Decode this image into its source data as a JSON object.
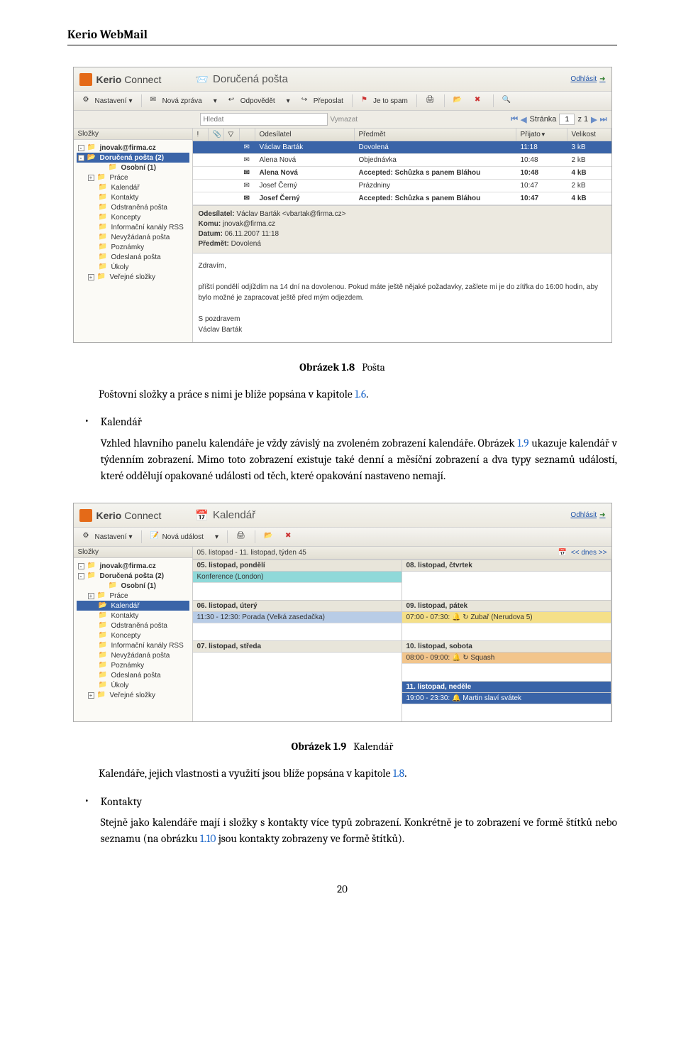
{
  "doc": {
    "header": "Kerio WebMail",
    "caption1_label": "Obrázek 1.8",
    "caption1_text": "Pošta",
    "para1": "Poštovní složky a práce s nimi je blíže popsána v kapitole ",
    "para1_link": "1.6",
    "para1_end": ".",
    "bullet1_title": "Kalendář",
    "bullet1_body_a": "Vzhled hlavního panelu kalendáře je vždy závislý na zvoleném zobrazení kalendáře. Obrázek ",
    "bullet1_link": "1.9",
    "bullet1_body_b": " ukazuje kalendář v týdenním zobrazení. Mimo toto zobrazení existuje také denní a měsíční zobrazení a dva typy seznamů událostí, které oddělují opakované události od těch, které opakování nastaveno nemají.",
    "caption2_label": "Obrázek 1.9",
    "caption2_text": "Kalendář",
    "para2_a": "Kalendáře, jejich vlastnosti a využití jsou blíže popsána v kapitole ",
    "para2_link": "1.8",
    "para2_end": ".",
    "bullet2_title": "Kontakty",
    "bullet2_body_a": "Stejně jako kalendáře mají i složky s kontakty více typů zobrazení. Konkrétně je to zobrazení ve formě štítků nebo seznamu (na obrázku ",
    "bullet2_link": "1.10",
    "bullet2_body_b": " jsou kontakty zobrazeny ve formě štítků).",
    "page_number": "20"
  },
  "app": {
    "brand": "Kerio",
    "product": "Connect",
    "title1": "Doručená pošta",
    "title2": "Kalendář",
    "logout": "Odhlásit"
  },
  "toolbar": {
    "settings": "Nastavení",
    "new_msg": "Nová zpráva",
    "reply": "Odpovědět",
    "forward": "Přeposlat",
    "spam": "Je to spam",
    "new_event": "Nová událost"
  },
  "search": {
    "placeholder": "Hledat",
    "clear": "Vymazat",
    "page_label": "Stránka",
    "page_value": "1",
    "page_total": "z 1"
  },
  "sidebar": {
    "header": "Složky",
    "items": [
      {
        "label": "jnovak@firma.cz",
        "exp": "-",
        "bold": true
      },
      {
        "label": "Doručená pošta (2)",
        "exp": "-",
        "bold": true,
        "sel_mail": true
      },
      {
        "label": "Osobní (1)",
        "bold": true,
        "indent": 2
      },
      {
        "label": "Práce",
        "exp": "+",
        "indent": 1
      },
      {
        "label": "Kalendář",
        "indent": 1,
        "sel_cal": true
      },
      {
        "label": "Kontakty",
        "indent": 1
      },
      {
        "label": "Odstraněná pošta",
        "indent": 1
      },
      {
        "label": "Koncepty",
        "indent": 1
      },
      {
        "label": "Informační kanály RSS",
        "indent": 1
      },
      {
        "label": "Nevyžádaná pošta",
        "indent": 1
      },
      {
        "label": "Poznámky",
        "indent": 1
      },
      {
        "label": "Odeslaná pošta",
        "indent": 1
      },
      {
        "label": "Úkoly",
        "indent": 1
      },
      {
        "label": "Veřejné složky",
        "exp": "+",
        "indent": 1
      }
    ]
  },
  "mail": {
    "cols": {
      "from": "Odesílatel",
      "subject": "Předmět",
      "date": "Přijato",
      "size": "Velikost"
    },
    "rows": [
      {
        "from": "Václav Barták",
        "subj": "Dovolená",
        "date": "11:18",
        "size": "3 kB",
        "sel": true
      },
      {
        "from": "Alena Nová",
        "subj": "Objednávka",
        "date": "10:48",
        "size": "2 kB"
      },
      {
        "from": "Alena Nová",
        "subj": "Accepted: Schůzka s panem Bláhou",
        "date": "10:48",
        "size": "4 kB",
        "bold": true
      },
      {
        "from": "Josef Černý",
        "subj": "Prázdniny",
        "date": "10:47",
        "size": "2 kB"
      },
      {
        "from": "Josef Černý",
        "subj": "Accepted: Schůzka s panem Bláhou",
        "date": "10:47",
        "size": "4 kB",
        "bold": true
      }
    ],
    "preview": {
      "from_label": "Odesílatel:",
      "from": "Václav Barták <vbartak@firma.cz>",
      "to_label": "Komu:",
      "to": "jnovak@firma.cz",
      "date_label": "Datum:",
      "date": "06.11.2007 11:18",
      "subj_label": "Předmět:",
      "subj": "Dovolená",
      "greeting": "Zdravím,",
      "body": "příští pondělí odjíždím na 14 dní na dovolenou. Pokud máte ještě nějaké požadavky, zašlete mi je do zítřka do 16:00 hodin, aby bylo možné je zapracovat ještě před mým odjezdem.",
      "sig1": "S pozdravem",
      "sig2": "Václav Barták"
    }
  },
  "calendar": {
    "range": "05. listopad - 11. listopad, týden 45",
    "today": "<< dnes >>",
    "days": [
      {
        "hdr": "05. listopad, pondělí",
        "events": [
          {
            "cls": "teal",
            "text": "Konference (London)"
          }
        ]
      },
      {
        "hdr": "06. listopad, úterý",
        "events": [
          {
            "cls": "blue",
            "text": "11:30 - 12:30: Porada (Velká zasedačka)"
          }
        ]
      },
      {
        "hdr": "07. listopad, středa",
        "events": []
      },
      {
        "hdr": "08. listopad, čtvrtek",
        "events": []
      },
      {
        "hdr": "09. listopad, pátek",
        "events": [
          {
            "cls": "yellow",
            "text": "07:00 - 07:30:  🔔 ↻  Zubař (Nerudova 5)"
          }
        ]
      },
      {
        "hdr": "10. listopad, sobota",
        "events": [
          {
            "cls": "peach",
            "text": "08:00 - 09:00:  🔔 ↻  Squash"
          }
        ]
      },
      {
        "hdr": "11. listopad, neděle",
        "sel": true,
        "events": [
          {
            "cls": "sun",
            "text": "19:00 - 23:30:  🔔  Martin slaví svátek"
          }
        ]
      }
    ]
  }
}
